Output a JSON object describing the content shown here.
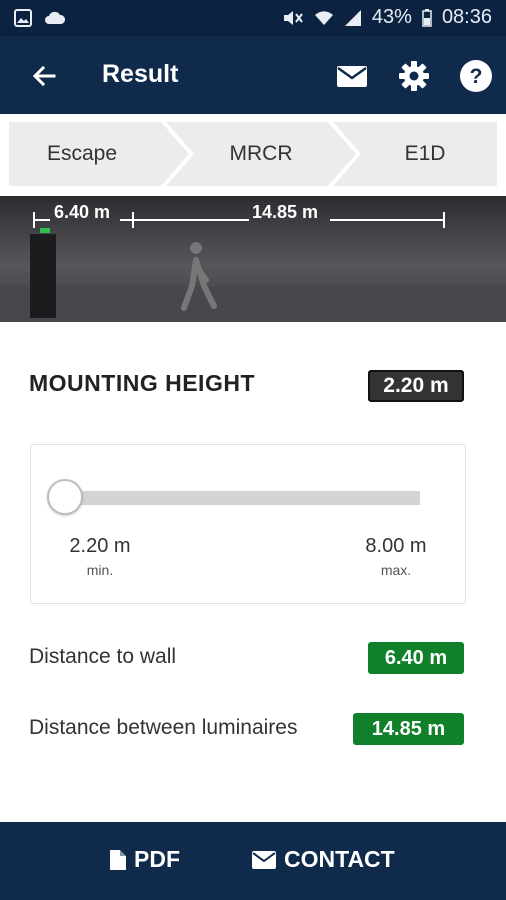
{
  "status_bar": {
    "battery": "43%",
    "time": "08:36"
  },
  "app_bar": {
    "title": "Result"
  },
  "breadcrumb": [
    "Escape",
    "MRCR",
    "E1D"
  ],
  "hero": {
    "dim_wall": "6.40 m",
    "dim_between": "14.85 m"
  },
  "mounting_height": {
    "label": "MOUNTING HEIGHT",
    "value": "2.20 m",
    "slider": {
      "min_value": "2.20 m",
      "min_label": "min.",
      "max_value": "8.00 m",
      "max_label": "max.",
      "position_fraction": 0.0
    }
  },
  "results": [
    {
      "label": "Distance to wall",
      "value": "6.40 m"
    },
    {
      "label": "Distance between luminaires",
      "value": "14.85 m"
    }
  ],
  "bottom_bar": {
    "pdf_label": "PDF",
    "contact_label": "CONTACT"
  },
  "colors": {
    "header": "#0f2a4a",
    "status": "#0b2240",
    "green": "#11802a",
    "dark_badge": "#333333"
  }
}
